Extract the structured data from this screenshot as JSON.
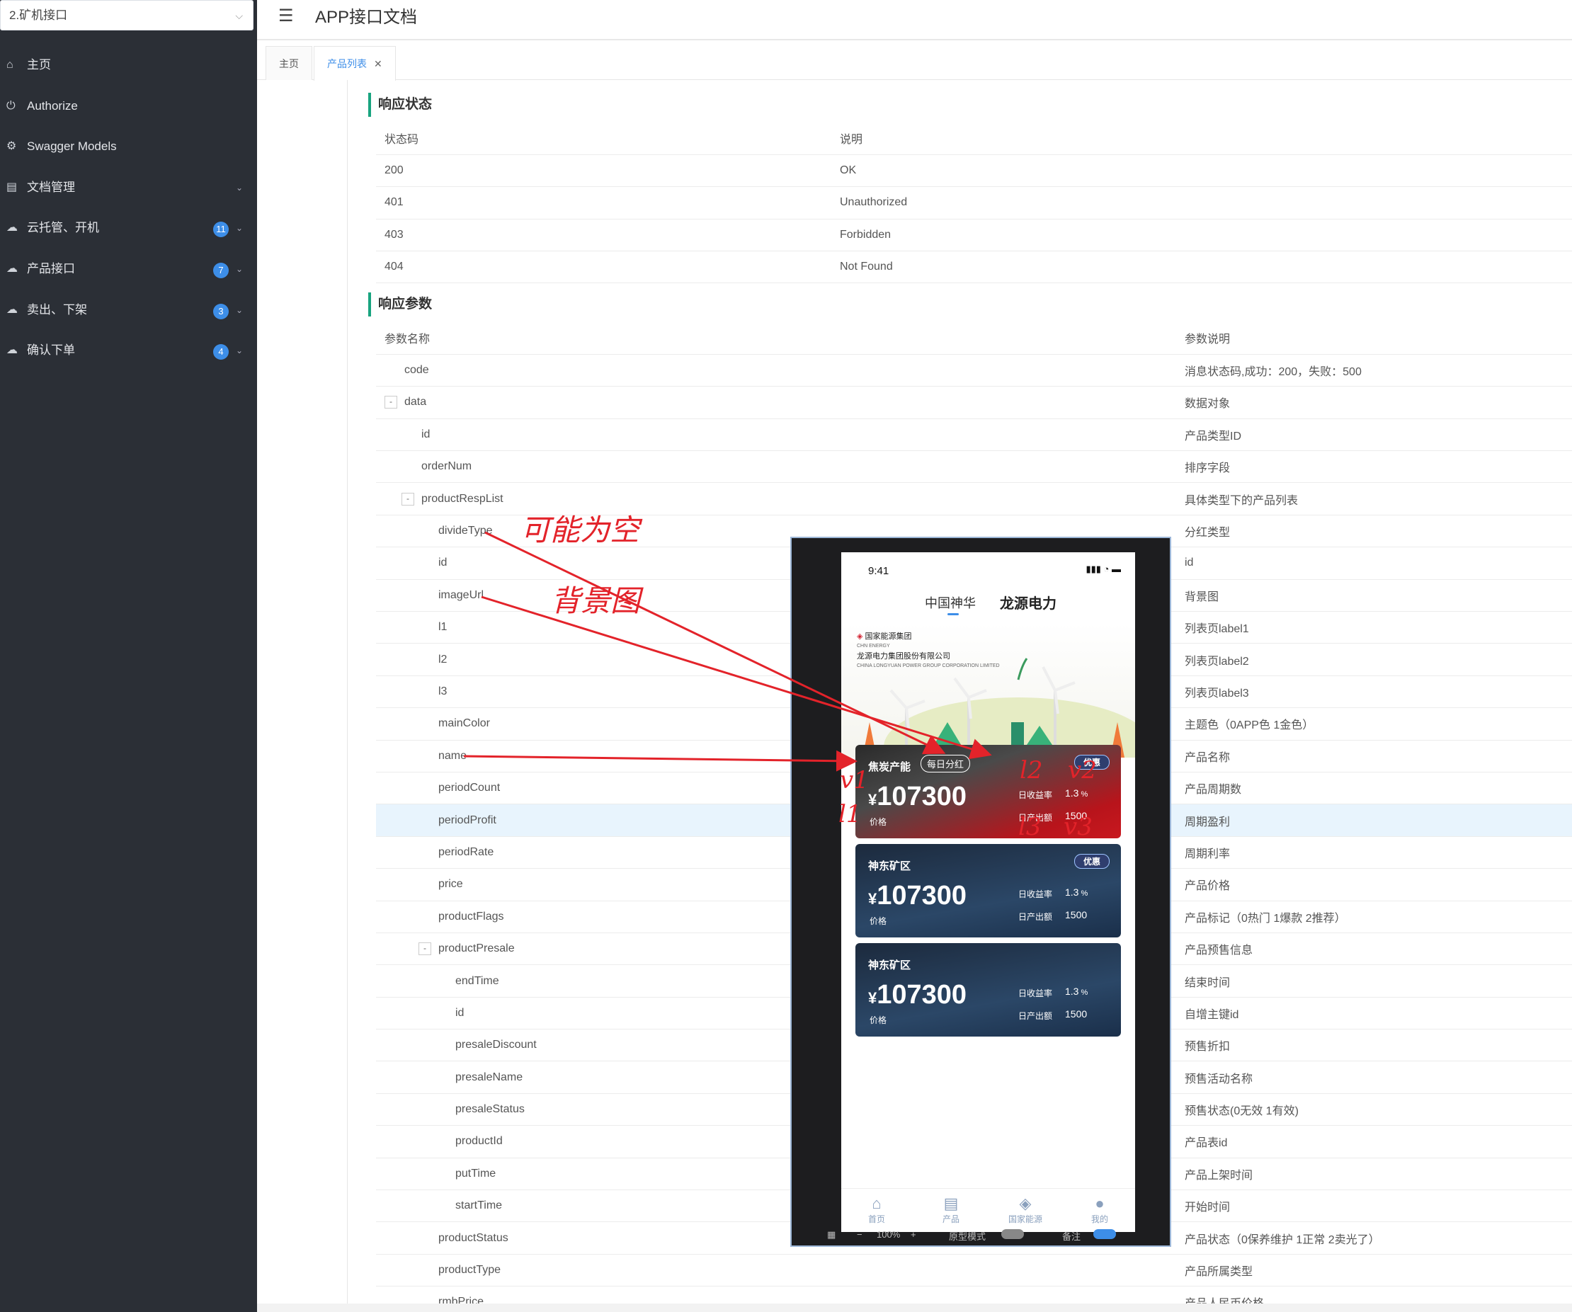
{
  "sidebar": {
    "select_value": "2.矿机接口",
    "items": [
      {
        "label": "主页",
        "icon": "home-icon",
        "glyph": "⌂"
      },
      {
        "label": "Authorize",
        "icon": "lock-icon",
        "glyph": "⏻"
      },
      {
        "label": "Swagger Models",
        "icon": "gear-icon",
        "glyph": "⚙"
      },
      {
        "label": "文档管理",
        "icon": "document-icon",
        "glyph": "▤",
        "arrow": "⌄"
      },
      {
        "label": "云托管、开机",
        "icon": "cloud-icon",
        "glyph": "☁",
        "badge": "11",
        "arrow": "⌄"
      },
      {
        "label": "产品接口",
        "icon": "cloud-icon",
        "glyph": "☁",
        "badge": "7",
        "arrow": "⌄"
      },
      {
        "label": "卖出、下架",
        "icon": "cloud-icon",
        "glyph": "☁",
        "badge": "3",
        "arrow": "⌄"
      },
      {
        "label": "确认下单",
        "icon": "cloud-icon",
        "glyph": "☁",
        "badge": "4",
        "arrow": "⌄"
      }
    ]
  },
  "header": {
    "title": "APP接口文档",
    "menu_glyph": "☰"
  },
  "tabs": [
    {
      "label": "主页"
    },
    {
      "label": "产品列表",
      "close": "✕"
    }
  ],
  "response_status": {
    "title": "响应状态",
    "headers": [
      "状态码",
      "说明"
    ],
    "rows": [
      [
        "200",
        "OK"
      ],
      [
        "401",
        "Unauthorized"
      ],
      [
        "403",
        "Forbidden"
      ],
      [
        "404",
        "Not Found"
      ]
    ]
  },
  "response_params": {
    "title": "响应参数",
    "headers": [
      "参数名称",
      "参数说明"
    ],
    "rows": [
      {
        "name": "code",
        "desc": "消息状态码,成功：200，失败：500",
        "level": 1
      },
      {
        "name": "data",
        "desc": "数据对象",
        "level": 1,
        "toggle": "-"
      },
      {
        "name": "id",
        "desc": "产品类型ID",
        "level": 2
      },
      {
        "name": "orderNum",
        "desc": "排序字段",
        "level": 2
      },
      {
        "name": "productRespList",
        "desc": "具体类型下的产品列表",
        "level": 2,
        "toggle": "-"
      },
      {
        "name": "divideType",
        "desc": "分红类型",
        "level": 3
      },
      {
        "name": "id",
        "desc": "id",
        "level": 3
      },
      {
        "name": "imageUrl",
        "desc": "背景图",
        "level": 3
      },
      {
        "name": "l1",
        "desc": "列表页label1",
        "level": 3
      },
      {
        "name": "l2",
        "desc": "列表页label2",
        "level": 3
      },
      {
        "name": "l3",
        "desc": "列表页label3",
        "level": 3
      },
      {
        "name": "mainColor",
        "desc": "主题色（0APP色 1金色）",
        "level": 3
      },
      {
        "name": "name",
        "desc": "产品名称",
        "level": 3
      },
      {
        "name": "periodCount",
        "desc": "产品周期数",
        "level": 3
      },
      {
        "name": "periodProfit",
        "desc": "周期盈利",
        "level": 3,
        "highlight": true
      },
      {
        "name": "periodRate",
        "desc": "周期利率",
        "level": 3
      },
      {
        "name": "price",
        "desc": "产品价格",
        "level": 3
      },
      {
        "name": "productFlags",
        "desc": "产品标记（0热门 1爆款 2推荐）",
        "level": 3
      },
      {
        "name": "productPresale",
        "desc": "产品预售信息",
        "level": 3,
        "toggle": "-"
      },
      {
        "name": "endTime",
        "desc": "结束时间",
        "level": 4
      },
      {
        "name": "id",
        "desc": "自增主键id",
        "level": 4
      },
      {
        "name": "presaleDiscount",
        "desc": "预售折扣",
        "level": 4
      },
      {
        "name": "presaleName",
        "desc": "预售活动名称",
        "level": 4
      },
      {
        "name": "presaleStatus",
        "desc": "预售状态(0无效 1有效)",
        "level": 4
      },
      {
        "name": "productId",
        "desc": "产品表id",
        "level": 4
      },
      {
        "name": "putTime",
        "desc": "产品上架时间",
        "level": 4
      },
      {
        "name": "startTime",
        "desc": "开始时间",
        "level": 4
      },
      {
        "name": "productStatus",
        "desc": "产品状态（0保养维护 1正常 2卖光了）",
        "level": 3
      },
      {
        "name": "productType",
        "desc": "产品所属类型",
        "level": 3
      },
      {
        "name": "rmbPrice",
        "desc": "产品人民币价格",
        "level": 3
      }
    ]
  },
  "phone": {
    "time": "9:41",
    "signal": "▮▮▮ ◔ ▬",
    "tab1": "中国神华",
    "tab2": "龙源电力",
    "logo_line1": "国家能源集团",
    "logo_line1b": "CHN ENERGY",
    "logo_line2": "龙源电力集团股份有限公司",
    "logo_line3": "CHINA LONGYUAN POWER GROUP CORPORATION LIMITED",
    "cards": [
      {
        "name": "焦炭产能",
        "tag": "每日分红",
        "badge": "优惠",
        "currency": "¥",
        "price": "107300",
        "price_label": "价格",
        "k1": "日收益率",
        "v1": "1.3",
        "v1_unit": "%",
        "k2": "日产出额",
        "v2": "1500"
      },
      {
        "name": "神东矿区",
        "badge": "优惠",
        "currency": "¥",
        "price": "107300",
        "price_label": "价格",
        "k1": "日收益率",
        "v1": "1.3",
        "v1_unit": "%",
        "k2": "日产出额",
        "v2": "1500"
      },
      {
        "name": "神东矿区",
        "currency": "¥",
        "price": "107300",
        "price_label": "价格",
        "k1": "日收益率",
        "v1": "1.3",
        "v1_unit": "%",
        "k2": "日产出额",
        "v2": "1500"
      }
    ],
    "bottom_nav": [
      {
        "label": "首页",
        "glyph": "⌂"
      },
      {
        "label": "产品",
        "glyph": "▤"
      },
      {
        "label": "国家能源",
        "glyph": "◈"
      },
      {
        "label": "我的",
        "glyph": "●"
      }
    ],
    "proto_bar": {
      "minus": "−",
      "zoom": "100%",
      "plus": "+",
      "mode": "原型模式",
      "note": "备注",
      "grid_glyph": "▦"
    }
  },
  "annotations": {
    "a1": "可能为空",
    "a2": "背景图",
    "v1": "v1",
    "l1": "l1",
    "l2": "l2",
    "v2": "v2",
    "l3": "l3",
    "v3": "v3"
  },
  "colors": {
    "accent": "#3d8ee8",
    "section_bar": "#19a47f",
    "annotation": "#e3232a",
    "sidebar_bg": "#2b2f36"
  }
}
